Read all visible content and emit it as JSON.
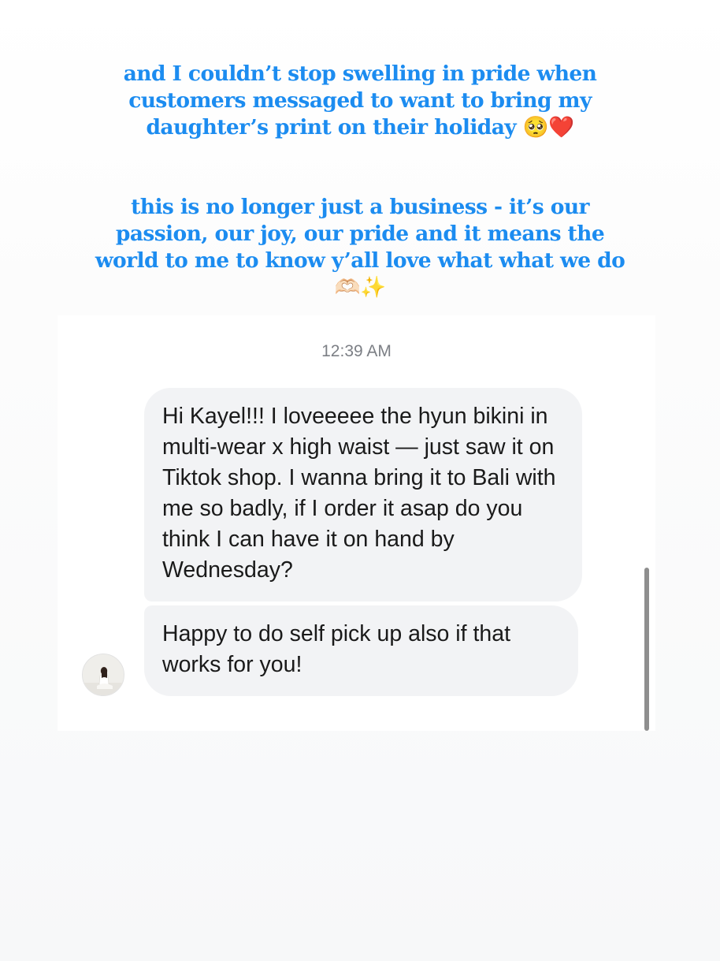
{
  "caption": {
    "paragraph_1": "and I couldn’t stop swelling in pride when customers messaged to want to bring my daughter’s print on their holiday 🥺❤️",
    "paragraph_2": "this is no longer just a business - it’s our passion, our joy, our pride and it means the world to me to know y’all love what what we do 🫶🏻✨"
  },
  "chat": {
    "timestamp": "12:39 AM",
    "messages": [
      {
        "text": "Hi Kayel!!! I loveeeee the hyun bikini in multi-wear x high waist — just saw it on Tiktok shop. I wanna bring it to Bali with me so badly, if I order it asap do you think I can have it on hand by Wednesday?"
      },
      {
        "text": "Happy to do self pick up also if that works for you!"
      }
    ]
  }
}
